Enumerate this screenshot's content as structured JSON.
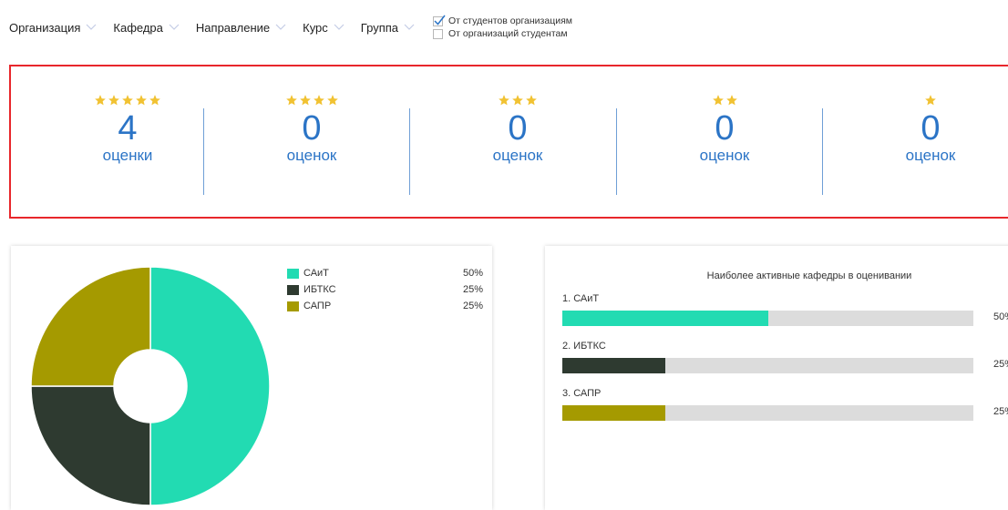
{
  "filters": [
    {
      "label": "Организация"
    },
    {
      "label": "Кафедра"
    },
    {
      "label": "Направление"
    },
    {
      "label": "Курс"
    },
    {
      "label": "Группа"
    }
  ],
  "direction_options": [
    {
      "label": "От студентов организациям",
      "checked": true
    },
    {
      "label": "От организаций студентам",
      "checked": false
    }
  ],
  "ratings": [
    {
      "stars": 5,
      "count": "4",
      "word": "оценки"
    },
    {
      "stars": 4,
      "count": "0",
      "word": "оценок"
    },
    {
      "stars": 3,
      "count": "0",
      "word": "оценок"
    },
    {
      "stars": 2,
      "count": "0",
      "word": "оценок"
    },
    {
      "stars": 1,
      "count": "0",
      "word": "оценок"
    }
  ],
  "colors": {
    "accent_blue": "#2b74c6",
    "highlight_border": "#e8262b",
    "star": "#f1c232"
  },
  "departments": [
    {
      "name": "САиТ",
      "percent": 50,
      "percent_label": "50%",
      "color": "#22dbb2"
    },
    {
      "name": "ИБТКС",
      "percent": 25,
      "percent_label": "25%",
      "color": "#2e3a30"
    },
    {
      "name": "САПР",
      "percent": 25,
      "percent_label": "25%",
      "color": "#a59a00"
    }
  ],
  "bars_panel": {
    "title": "Наиболее активные кафедры в оценивании",
    "items": [
      {
        "label": "1. САиТ",
        "percent": 50,
        "percent_label": "50%",
        "color": "#22dbb2"
      },
      {
        "label": "2. ИБТКС",
        "percent": 25,
        "percent_label": "25%",
        "color": "#2e3a30"
      },
      {
        "label": "3. САПР",
        "percent": 25,
        "percent_label": "25%",
        "color": "#a59a00"
      }
    ]
  },
  "chart_data": [
    {
      "type": "pie",
      "categories": [
        "САиТ",
        "ИБТКС",
        "САПР"
      ],
      "values": [
        50,
        25,
        25
      ],
      "legend": "right"
    },
    {
      "type": "bar",
      "title": "Наиболее активные кафедры в оценивании",
      "categories": [
        "1. САиТ",
        "2. ИБТКС",
        "3. САПР"
      ],
      "values": [
        50,
        25,
        25
      ],
      "ylim": [
        0,
        100
      ]
    }
  ]
}
